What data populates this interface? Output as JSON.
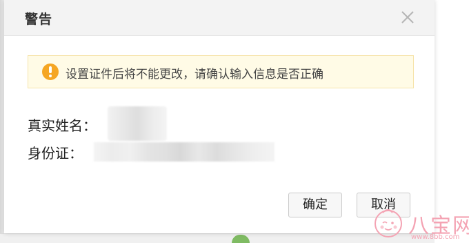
{
  "dialog": {
    "title": "警告",
    "close_icon": "close-icon",
    "notice": {
      "icon": "warning-icon",
      "text": "设置证件后将不能更改，请确认输入信息是否正确",
      "icon_color": "#f5a623",
      "background": "#fffbe6"
    },
    "fields": {
      "name_label": "真实姓名：",
      "id_label": "身份证："
    },
    "buttons": {
      "confirm": "确定",
      "cancel": "取消"
    }
  },
  "watermark": {
    "brand": "八宝网",
    "url": "www.8bb.com",
    "color": "#f4a3b3"
  }
}
